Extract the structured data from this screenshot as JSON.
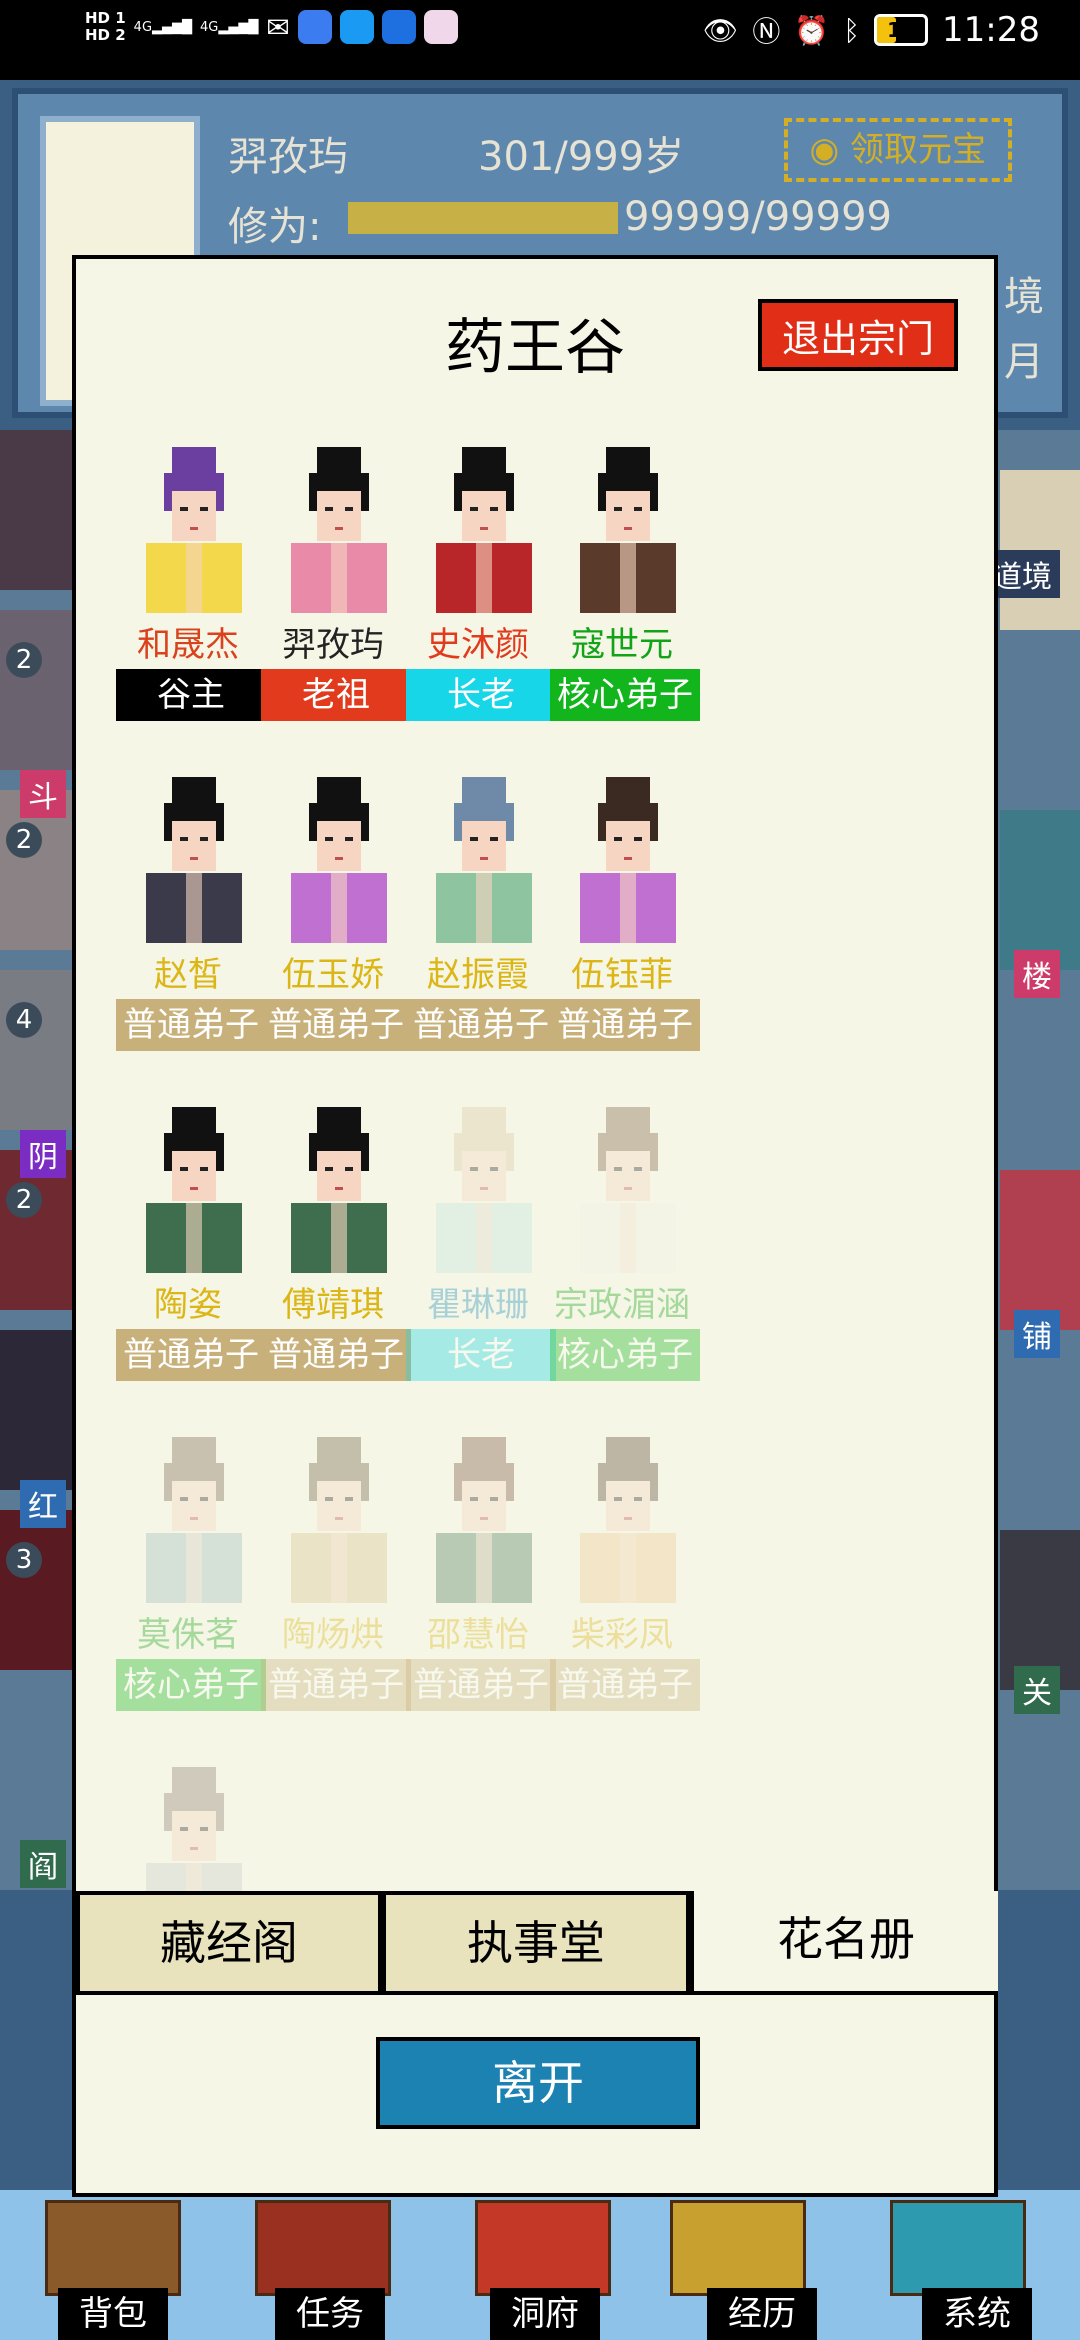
{
  "status_bar": {
    "sim1": "HD 1",
    "sim2": "HD 2",
    "net1": "4G",
    "net2": "4G",
    "battery": "13",
    "time": "11:28"
  },
  "background": {
    "player_name": "羿孜玙",
    "age": "301/999岁",
    "claim_button": "领取元宝",
    "cultivation_label": "修为:",
    "cultivation_value": "99999/99999",
    "realm_char": "境",
    "month_char": "月",
    "side_badges": [
      "2",
      "2",
      "4",
      "2",
      "3"
    ],
    "side_places_left": [
      "斗",
      "阴",
      "红",
      "阎"
    ],
    "side_places_right": [
      "道境",
      "楼",
      "铺",
      "关"
    ]
  },
  "bottom_nav": [
    "背包",
    "任务",
    "洞府",
    "经历",
    "系统"
  ],
  "modal": {
    "title": "药王谷",
    "exit_button": "退出宗门",
    "members": [
      {
        "name": "和晟杰",
        "rank": "谷主",
        "name_color": "#d9421d",
        "rank_color": "#000000",
        "faded": false
      },
      {
        "name": "羿孜玙",
        "rank": "老祖",
        "name_color": "#222222",
        "rank_color": "#e23a1c",
        "faded": false
      },
      {
        "name": "史沐颜",
        "rank": "长老",
        "name_color": "#e23a1c",
        "rank_color": "#16d6e8",
        "faded": false
      },
      {
        "name": "寇世元",
        "rank": "核心弟子",
        "name_color": "#12a418",
        "rank_color": "#12b61c",
        "faded": false
      },
      {
        "name": "赵皙",
        "rank": "普通弟子",
        "name_color": "#dcb617",
        "rank_color": "#c8b07a",
        "faded": false
      },
      {
        "name": "伍玉娇",
        "rank": "普通弟子",
        "name_color": "#dcb617",
        "rank_color": "#c8b07a",
        "faded": false
      },
      {
        "name": "赵振霞",
        "rank": "普通弟子",
        "name_color": "#dcb617",
        "rank_color": "#c8b07a",
        "faded": false
      },
      {
        "name": "伍钰菲",
        "rank": "普通弟子",
        "name_color": "#dcb617",
        "rank_color": "#c8b07a",
        "faded": false
      },
      {
        "name": "陶姿",
        "rank": "普通弟子",
        "name_color": "#dcb617",
        "rank_color": "#c8b07a",
        "faded": false
      },
      {
        "name": "傅靖琪",
        "rank": "普通弟子",
        "name_color": "#dcb617",
        "rank_color": "#c8b07a",
        "faded": false
      },
      {
        "name": "瞿琳珊",
        "rank": "长老",
        "name_color": "#1a8fbf",
        "rank_color": "#16d6e8",
        "faded": true
      },
      {
        "name": "宗政湄涵",
        "rank": "核心弟子",
        "name_color": "#12a418",
        "rank_color": "#12b61c",
        "faded": true
      },
      {
        "name": "莫侏茗",
        "rank": "核心弟子",
        "name_color": "#12a418",
        "rank_color": "#12b61c",
        "faded": true
      },
      {
        "name": "陶炀烘",
        "rank": "普通弟子",
        "name_color": "#dcb617",
        "rank_color": "#c8b07a",
        "faded": true
      },
      {
        "name": "邵慧怡",
        "rank": "普通弟子",
        "name_color": "#dcb617",
        "rank_color": "#c8b07a",
        "faded": true
      },
      {
        "name": "柴彩凤",
        "rank": "普通弟子",
        "name_color": "#dcb617",
        "rank_color": "#c8b07a",
        "faded": true
      },
      {
        "name": "",
        "rank": "",
        "name_color": "#dcb617",
        "rank_color": "transparent",
        "faded": true
      }
    ],
    "tabs": [
      {
        "label": "藏经阁",
        "active": false
      },
      {
        "label": "执事堂",
        "active": false
      },
      {
        "label": "花名册",
        "active": true
      }
    ],
    "leave_button": "离开"
  },
  "colors": {
    "modal_bg": "#f5f6e5",
    "tab_inactive": "#e8e2bd",
    "exit_red": "#e02e17",
    "leave_blue": "#1c82b2"
  }
}
